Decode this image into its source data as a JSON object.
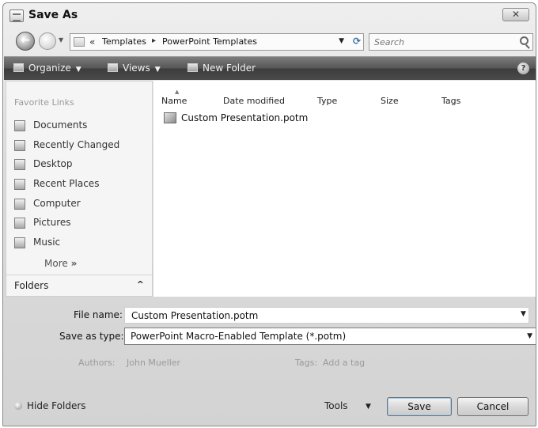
{
  "window": {
    "title": "Save As"
  },
  "nav": {
    "breadcrumb": [
      "Templates",
      "PowerPoint Templates"
    ],
    "overflow": "«",
    "separator": "▸",
    "search_placeholder": "Search"
  },
  "toolbar": {
    "organize": "Organize",
    "views": "Views",
    "new_folder": "New Folder",
    "help": "?"
  },
  "sidebar": {
    "heading": "Favorite Links",
    "items": [
      {
        "label": "Documents",
        "icon": "documents-icon"
      },
      {
        "label": "Recently Changed",
        "icon": "recently-changed-icon"
      },
      {
        "label": "Desktop",
        "icon": "desktop-icon"
      },
      {
        "label": "Recent Places",
        "icon": "recent-places-icon"
      },
      {
        "label": "Computer",
        "icon": "computer-icon"
      },
      {
        "label": "Pictures",
        "icon": "pictures-icon"
      },
      {
        "label": "Music",
        "icon": "music-icon"
      }
    ],
    "more": "More",
    "more_arrow": "»",
    "folders": "Folders",
    "folders_chevron": "^"
  },
  "filelist": {
    "columns": [
      "Name",
      "Date modified",
      "Type",
      "Size",
      "Tags"
    ],
    "files": [
      {
        "name": "Custom Presentation.potm"
      }
    ]
  },
  "form": {
    "file_name_label": "File name:",
    "file_name_value": "Custom Presentation.potm",
    "save_as_type_label": "Save as type:",
    "save_as_type_value": "PowerPoint Macro-Enabled Template (*.potm)",
    "authors_label": "Authors:",
    "authors_value": "John Mueller",
    "tags_label": "Tags:",
    "tags_value": "Add a tag"
  },
  "footer": {
    "hide_folders": "Hide Folders",
    "tools": "Tools",
    "save": "Save",
    "cancel": "Cancel"
  }
}
